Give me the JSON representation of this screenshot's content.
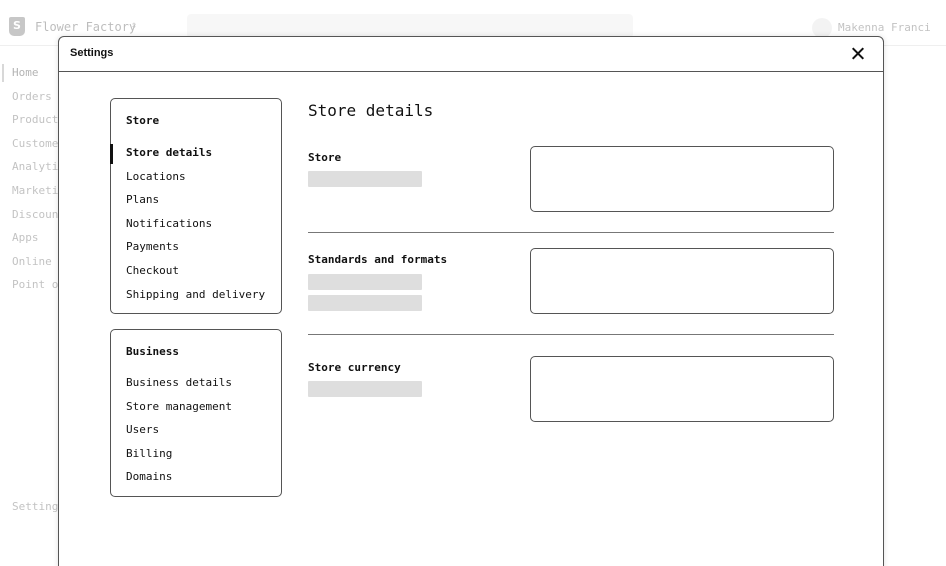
{
  "background": {
    "store_name": "Flower Factory",
    "store_chevron": "⇕",
    "user_name": "Makenna Franci",
    "nav": [
      "Home",
      "Orders",
      "Product",
      "Custome",
      "Analyti",
      "Marketi",
      "Discoun",
      "Apps",
      "Online S",
      "Point of"
    ],
    "settings_label": "Setting"
  },
  "modal": {
    "title": "Settings",
    "close_icon": "close-icon"
  },
  "sidebar": {
    "store": {
      "heading": "Store",
      "items": [
        {
          "label": "Store details",
          "active": true
        },
        {
          "label": "Locations"
        },
        {
          "label": "Plans"
        },
        {
          "label": "Notifications"
        },
        {
          "label": "Payments"
        },
        {
          "label": "Checkout"
        },
        {
          "label": "Shipping and delivery"
        }
      ]
    },
    "business": {
      "heading": "Business",
      "items": [
        {
          "label": "Business details"
        },
        {
          "label": "Store management"
        },
        {
          "label": "Users"
        },
        {
          "label": "Billing"
        },
        {
          "label": "Domains"
        }
      ]
    }
  },
  "main": {
    "title": "Store details",
    "sections": [
      {
        "label": "Store"
      },
      {
        "label": "Standards and formats"
      },
      {
        "label": "Store currency"
      }
    ]
  }
}
